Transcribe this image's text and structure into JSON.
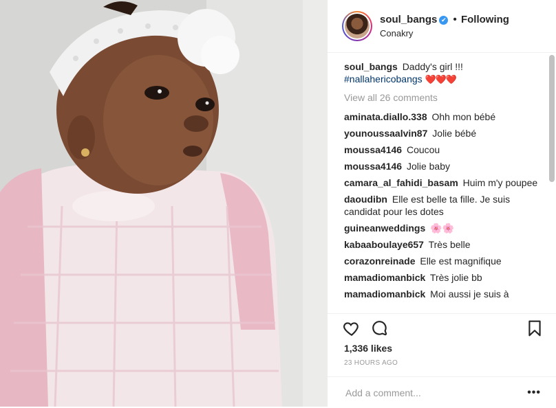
{
  "post": {
    "username": "soul_bangs",
    "verified_glyph": "✔",
    "separator": "•",
    "follow_status": "Following",
    "location": "Conakry"
  },
  "caption": {
    "username": "soul_bangs",
    "text": "Daddy's girl !!!",
    "hashtag": "#nallahericobangs",
    "emoji": "❤️❤️❤️"
  },
  "view_all_label": "View all 26 comments",
  "comments": [
    {
      "user": "aminata.diallo.338",
      "text": "Ohh mon bébé"
    },
    {
      "user": "younoussaalvin87",
      "text": "Jolie bébé"
    },
    {
      "user": "moussa4146",
      "text": "Coucou"
    },
    {
      "user": "moussa4146",
      "text": "Jolie baby"
    },
    {
      "user": "camara_al_fahidi_basam",
      "text": "Huim m'y poupee"
    },
    {
      "user": "daoudibn",
      "text": "Elle est belle ta fille. Je suis candidat pour les dotes"
    },
    {
      "user": "guineanweddings",
      "text": "🌸🌸"
    },
    {
      "user": "kabaaboulaye657",
      "text": "Très belle"
    },
    {
      "user": "corazonreinade",
      "text": "Elle est magnifique"
    },
    {
      "user": "mamadiomanbick",
      "text": "Très jolie bb"
    },
    {
      "user": "mamadiomanbick",
      "text": "Moi aussi je suis à"
    }
  ],
  "likes": "1,336 likes",
  "timestamp": "23 HOURS AGO",
  "add_comment_placeholder": "Add a comment...",
  "more_options": "•••",
  "icons": [
    "heart-icon",
    "comment-icon",
    "bookmark-icon",
    "verified-icon"
  ],
  "colors": {
    "accent": "#3897f0",
    "hashtag": "#003569",
    "muted": "#999999",
    "heart": "#ed4956"
  }
}
